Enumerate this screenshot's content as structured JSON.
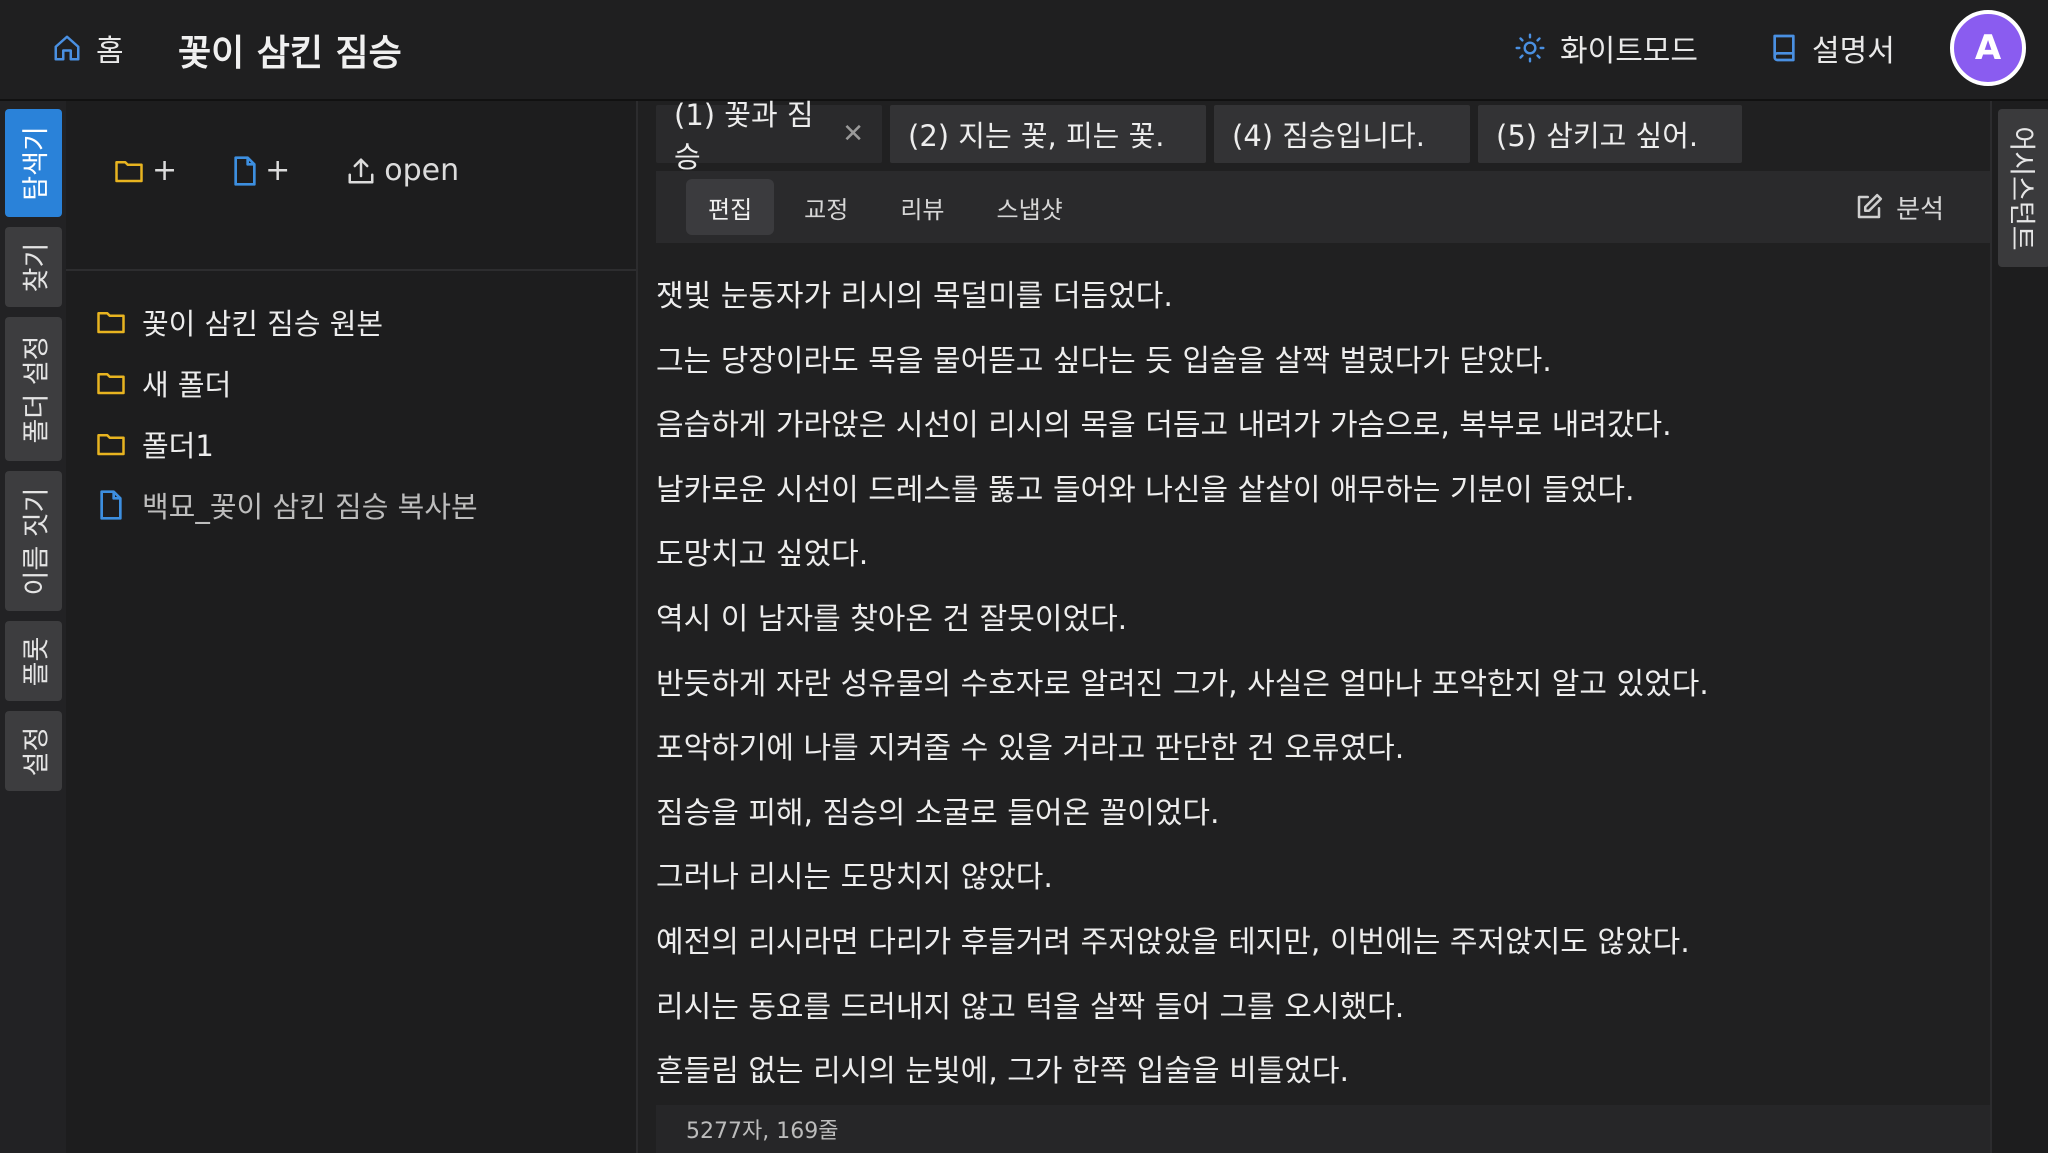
{
  "header": {
    "home_label": "홈",
    "title": "꽃이 삼킨 짐승",
    "theme_label": "화이트모드",
    "manual_label": "설명서",
    "avatar_letter": "A"
  },
  "left_tabs": [
    {
      "label": "탐색기",
      "active": true
    },
    {
      "label": "찾기"
    },
    {
      "label": "폴더 설정"
    },
    {
      "label": "이름 짓기"
    },
    {
      "label": "플롯"
    },
    {
      "label": "설정"
    }
  ],
  "explorer": {
    "new_folder_label": "+",
    "new_file_label": "+",
    "open_label": "open",
    "items": [
      {
        "type": "folder",
        "name": "꽃이 삼킨 짐승 원본"
      },
      {
        "type": "folder",
        "name": "새 폴더"
      },
      {
        "type": "folder",
        "name": "폴더1"
      },
      {
        "type": "file",
        "name": "백묘_꽃이 삼킨 짐승 복사본"
      }
    ]
  },
  "editor": {
    "tabs": [
      {
        "label": "(1) 꽃과 짐승",
        "active": true,
        "close": "✕"
      },
      {
        "label": "(2) 지는 꽃, 피는 꽃."
      },
      {
        "label": "(4) 짐승입니다."
      },
      {
        "label": "(5) 삼키고 싶어."
      }
    ],
    "modes": [
      "편집",
      "교정",
      "리뷰",
      "스냅샷"
    ],
    "analysis_label": "분석",
    "lines": [
      "잿빛 눈동자가 리시의 목덜미를 더듬었다.",
      "그는 당장이라도 목을 물어뜯고 싶다는 듯 입술을 살짝 벌렸다가 닫았다.",
      "음습하게 가라앉은 시선이 리시의 목을 더듬고 내려가 가슴으로, 복부로 내려갔다.",
      "날카로운 시선이 드레스를 뚫고 들어와 나신을 샅샅이 애무하는 기분이 들었다.",
      "도망치고 싶었다.",
      "역시 이 남자를 찾아온 건 잘못이었다.",
      "반듯하게 자란 성유물의 수호자로 알려진 그가, 사실은 얼마나 포악한지 알고 있었다.",
      "포악하기에 나를 지켜줄 수 있을 거라고 판단한 건 오류였다.",
      "짐승을 피해, 짐승의 소굴로 들어온 꼴이었다.",
      "그러나 리시는 도망치지 않았다.",
      "예전의 리시라면 다리가 후들거려 주저앉았을 테지만, 이번에는 주저앉지도 않았다.",
      "리시는 동요를 드러내지 않고 턱을 살짝 들어 그를 오시했다.",
      "흔들림 없는 리시의 눈빛에, 그가 한쪽 입술을 비틀었다."
    ],
    "status": "5277자, 169줄"
  },
  "assistant_label": "어시스턴트",
  "colors": {
    "accent": "#2a82d9",
    "folder": "#e8b420",
    "file": "#3d8fe0",
    "avatar": "#8a5cf0"
  }
}
